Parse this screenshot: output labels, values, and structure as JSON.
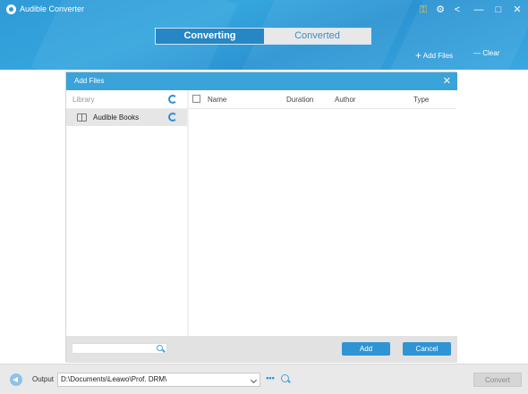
{
  "app": {
    "title": "Audible Converter"
  },
  "titlebar": {
    "icons": [
      "key-icon",
      "gear-icon",
      "share-icon",
      "minimize-icon",
      "maximize-icon",
      "close-icon"
    ]
  },
  "tabs": [
    {
      "label": "Converting",
      "active": true
    },
    {
      "label": "Converted",
      "active": false
    }
  ],
  "header_actions": {
    "add_files": "Add Files",
    "clear": "Clear"
  },
  "dialog": {
    "title": "Add Files",
    "library": {
      "label": "Library",
      "items": [
        {
          "label": "Audible Books"
        }
      ]
    },
    "columns": [
      "Name",
      "Duration",
      "Author",
      "Type"
    ],
    "rows": [],
    "search": {
      "placeholder": ""
    },
    "buttons": {
      "add": "Add",
      "cancel": "Cancel"
    }
  },
  "output": {
    "label": "Output",
    "path": "D:\\Documents\\Leawo\\Prof. DRM\\"
  },
  "convert_button": "Convert",
  "colors": {
    "header_blue": "#2f9ad6",
    "tab_active": "#2786c4",
    "dialog_header": "#3aa3da",
    "button_blue": "#2e94d4"
  }
}
